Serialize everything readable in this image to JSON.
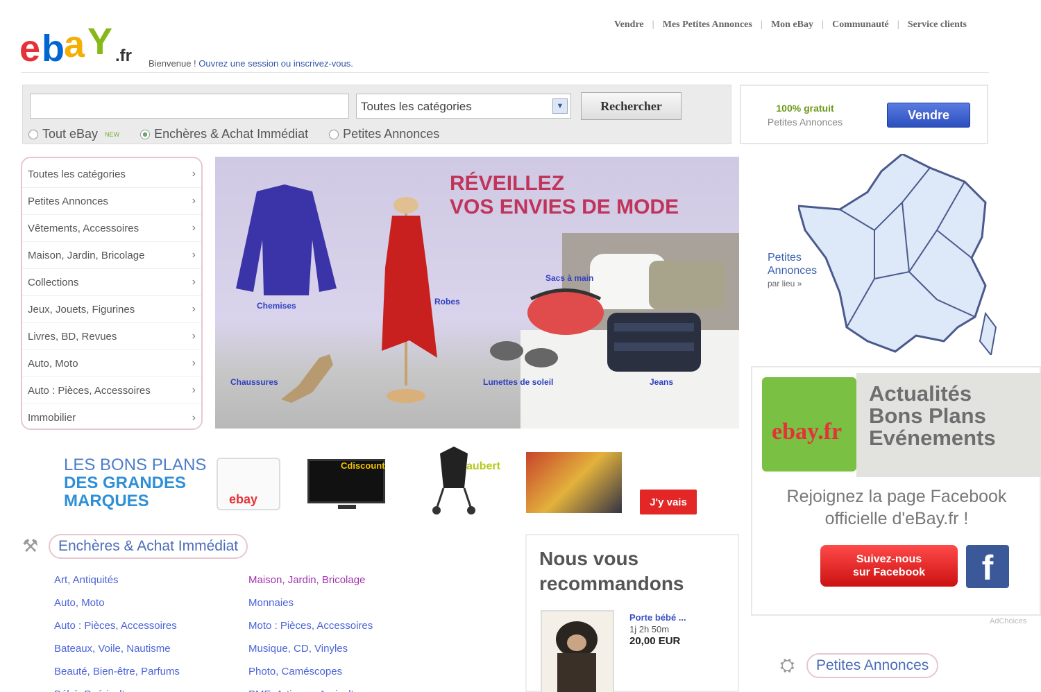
{
  "header": {
    "logo_text": "ebay.fr",
    "welcome_text": "Bienvenue !",
    "welcome_link": "Ouvrez une session ou inscrivez-vous.",
    "nav": [
      "Vendre",
      "Mes Petites Annonces",
      "Mon eBay",
      "Communauté",
      "Service clients"
    ]
  },
  "search": {
    "input_value": "",
    "category_selected": "Toutes les catégories",
    "button_label": "Rechercher",
    "scope_options": [
      {
        "label": "Tout eBay",
        "badge": "NEW",
        "checked": false
      },
      {
        "label": "Enchères & Achat Immédiat",
        "checked": true
      },
      {
        "label": "Petites Annonces",
        "checked": false
      }
    ]
  },
  "sell": {
    "free_label": "100% gratuit",
    "sub_label": "Petites Annonces",
    "button_label": "Vendre"
  },
  "categories": [
    "Toutes les catégories",
    "Petites Annonces",
    "Vêtements, Accessoires",
    "Maison, Jardin, Bricolage",
    "Collections",
    "Jeux, Jouets, Figurines",
    "Livres, BD, Revues",
    "Auto, Moto",
    "Auto : Pièces, Accessoires",
    "Immobilier"
  ],
  "banner": {
    "title_line1": "RÉVEILLEZ",
    "title_line2": "VOS ENVIES DE MODE",
    "labels": {
      "chemises": "Chemises",
      "robes": "Robes",
      "sacs": "Sacs à main",
      "chaussures": "Chaussures",
      "lunettes": "Lunettes de soleil",
      "jeans": "Jeans"
    }
  },
  "map": {
    "label_line1": "Petites",
    "label_line2": "Annonces",
    "label_small": "par lieu »"
  },
  "promo": {
    "line1": "LES BONS PLANS",
    "line2": "DES GRANDES",
    "line3": "MARQUES",
    "brand1": "ebay",
    "brand2": "Cdiscount",
    "brand3": "aubert",
    "button_label": "J'y vais"
  },
  "facebook": {
    "tile_text": "ebay.fr",
    "news_lines": [
      "Actualités",
      "Bons Plans",
      "Evénements"
    ],
    "join_line1": "Rejoignez la page Facebook",
    "join_line2": "officielle d'eBay.fr !",
    "follow_line1": "Suivez-nous",
    "follow_line2": "sur Facebook",
    "icon_letter": "f",
    "ad_choice": "AdChoices"
  },
  "auctions": {
    "title": "Enchères & Achat Immédiat",
    "col1": [
      "Art, Antiquités",
      "Auto, Moto",
      "Auto : Pièces, Accessoires",
      "Bateaux, Voile, Nautisme",
      "Beauté, Bien-être, Parfums",
      "Bébé, Puériculture"
    ],
    "col2": [
      "Maison, Jardin, Bricolage",
      "Monnaies",
      "Moto : Pièces, Accessoires",
      "Musique, CD, Vinyles",
      "Photo, Caméscopes",
      "PME, Artisans, Agriculteurs"
    ]
  },
  "recommend": {
    "title_line1": "Nous vous",
    "title_line2": "recommandons",
    "item_title": "Porte bébé ...",
    "item_time": "1j 2h 50m",
    "item_price": "20,00 EUR"
  },
  "petites_annonces": {
    "title": "Petites Annonces"
  }
}
